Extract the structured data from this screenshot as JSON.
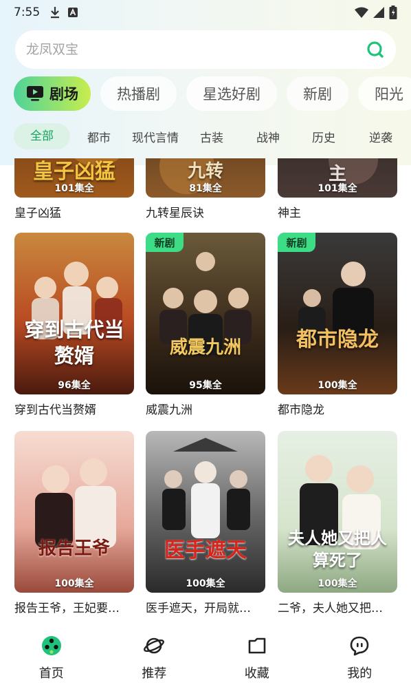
{
  "status_bar": {
    "time": "7:55"
  },
  "search": {
    "placeholder": "龙凤双宝"
  },
  "category_tabs": [
    "剧场",
    "热播剧",
    "星选好剧",
    "新剧",
    "阳光"
  ],
  "genre_tabs": [
    "全部",
    "都市",
    "现代言情",
    "古装",
    "战神",
    "历史",
    "逆袭"
  ],
  "dramas": [
    {
      "title": "皇子凶猛",
      "episodes": "101集全",
      "poster_text": "皇子凶猛",
      "is_new": false
    },
    {
      "title": "九转星辰诀",
      "episodes": "81集全",
      "poster_text": "九转",
      "is_new": false
    },
    {
      "title": "神主",
      "episodes": "101集全",
      "poster_text": "主",
      "is_new": false
    },
    {
      "title": "穿到古代当赘婿",
      "episodes": "96集全",
      "poster_text": "穿到古代当赘婿",
      "is_new": false
    },
    {
      "title": "威震九洲",
      "episodes": "95集全",
      "poster_text": "威震九洲",
      "is_new": true
    },
    {
      "title": "都市隐龙",
      "episodes": "100集全",
      "poster_text": "都市隐龙",
      "is_new": true
    },
    {
      "title": "报告王爷，王妃要…",
      "episodes": "100集全",
      "poster_text": "报告王爷",
      "is_new": false
    },
    {
      "title": "医手遮天，开局就…",
      "episodes": "100集全",
      "poster_text": "医手遮天",
      "is_new": false
    },
    {
      "title": "二爷，夫人她又把…",
      "episodes": "100集全",
      "poster_text": "夫人她又把人算死了",
      "is_new": false
    }
  ],
  "new_badge": "新剧",
  "bottom_nav": [
    "首页",
    "推荐",
    "收藏",
    "我的"
  ],
  "colors": {
    "accent": "#16a35f",
    "badge": "#3ddc86",
    "active_tab_start": "#4fd39a",
    "active_tab_end": "#c8ed4e"
  }
}
